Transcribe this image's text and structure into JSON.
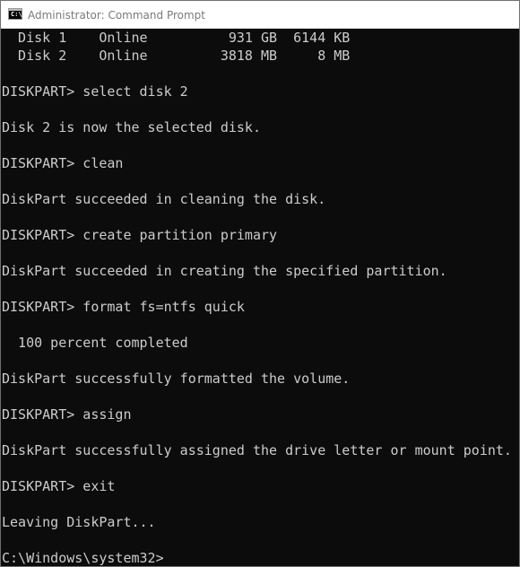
{
  "window": {
    "title": "Administrator: Command Prompt",
    "icon_name": "command-prompt-icon",
    "icon_text": "C:\\"
  },
  "console": {
    "lines": [
      "  Disk 1    Online          931 GB  6144 KB",
      "  Disk 2    Online         3818 MB     8 MB",
      "",
      "DISKPART> select disk 2",
      "",
      "Disk 2 is now the selected disk.",
      "",
      "DISKPART> clean",
      "",
      "DiskPart succeeded in cleaning the disk.",
      "",
      "DISKPART> create partition primary",
      "",
      "DiskPart succeeded in creating the specified partition.",
      "",
      "DISKPART> format fs=ntfs quick",
      "",
      "  100 percent completed",
      "",
      "DiskPart successfully formatted the volume.",
      "",
      "DISKPART> assign",
      "",
      "DiskPart successfully assigned the drive letter or mount point.",
      "",
      "DISKPART> exit",
      "",
      "Leaving DiskPart...",
      "",
      "C:\\Windows\\system32>"
    ]
  },
  "colors": {
    "console_background": "#0c0c0c",
    "console_text": "#cccccc",
    "titlebar_background": "#ffffff",
    "title_text": "#7a7a7a"
  }
}
